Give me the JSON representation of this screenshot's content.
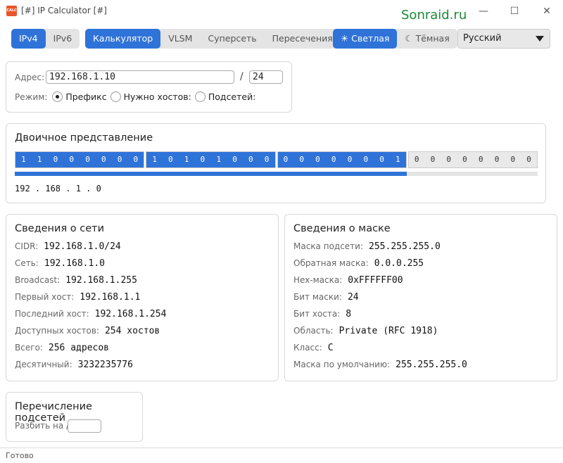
{
  "window": {
    "icon_text": "CALC",
    "title": "[#] IP Calculator [#]",
    "brand": "Sonraid.ru",
    "minimize": "—",
    "maximize": "☐",
    "close": "✕"
  },
  "ip_version": {
    "options": [
      "IPv4",
      "IPv6"
    ],
    "selected": "IPv4"
  },
  "modes": {
    "options": [
      "Калькулятор",
      "VLSM",
      "Суперсеть",
      "Пересечения"
    ],
    "selected": "Калькулятор"
  },
  "theme": {
    "light": "☀ Светлая",
    "dark": "☾ Тёмная",
    "selected": "light"
  },
  "language": {
    "selected": "Русский"
  },
  "address": {
    "label": "Адрес:",
    "ip_value": "192.168.1.10",
    "slash": "/",
    "prefix_value": "24",
    "mode_label": "Режим:",
    "mode_options": [
      "Префикс",
      "Нужно хостов:",
      "Подсетей:"
    ],
    "mode_selected": 0
  },
  "binary": {
    "title": "Двоичное представление",
    "octets": [
      [
        "1",
        "1",
        "0",
        "0",
        "0",
        "0",
        "0",
        "0"
      ],
      [
        "1",
        "0",
        "1",
        "0",
        "1",
        "0",
        "0",
        "0"
      ],
      [
        "0",
        "0",
        "0",
        "0",
        "0",
        "0",
        "0",
        "1"
      ],
      [
        "0",
        "0",
        "0",
        "0",
        "0",
        "0",
        "0",
        "0"
      ]
    ],
    "prefix_bits": 24,
    "dotted": "192 . 168 . 1 . 0"
  },
  "network_info": {
    "title": "Сведения о сети",
    "rows": [
      {
        "label": "CIDR:",
        "value": "192.168.1.0/24"
      },
      {
        "label": "Сеть:",
        "value": "192.168.1.0"
      },
      {
        "label": "Broadcast:",
        "value": "192.168.1.255"
      },
      {
        "label": "Первый хост:",
        "value": "192.168.1.1"
      },
      {
        "label": "Последний хост:",
        "value": "192.168.1.254"
      },
      {
        "label": "Доступных хостов:",
        "value": "254 хостов"
      },
      {
        "label": "Всего:",
        "value": "256 адресов"
      },
      {
        "label": "Десятичный:",
        "value": "3232235776"
      }
    ]
  },
  "mask_info": {
    "title": "Сведения о маске",
    "rows": [
      {
        "label": "Маска подсети:",
        "value": "255.255.255.0"
      },
      {
        "label": "Обратная маска:",
        "value": "0.0.0.255"
      },
      {
        "label": "Hex-маска:",
        "value": "0xFFFFFF00"
      },
      {
        "label": "Бит маски:",
        "value": "24"
      },
      {
        "label": "Бит хоста:",
        "value": "8"
      },
      {
        "label": "Область:",
        "value": "Private (RFC 1918)"
      },
      {
        "label": "Класс:",
        "value": "C"
      },
      {
        "label": "Маска по умолчанию:",
        "value": "255.255.255.0"
      }
    ]
  },
  "subnets": {
    "title": "Перечисление подсетей",
    "split_label": "Разбить на /",
    "split_value": ""
  },
  "status": {
    "text": "Готово"
  }
}
